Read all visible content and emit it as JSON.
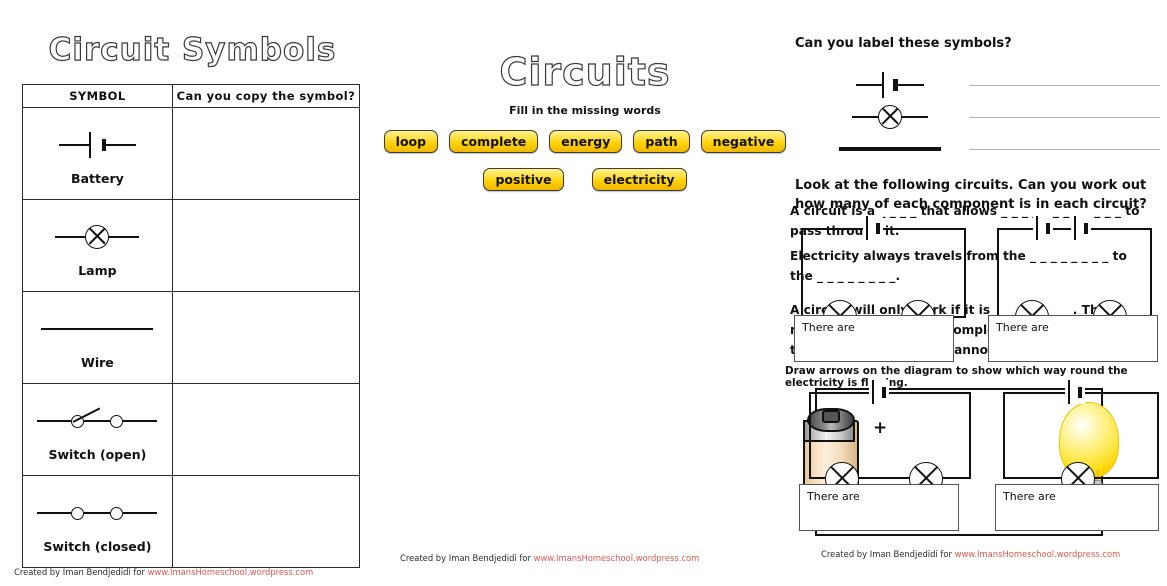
{
  "left": {
    "title": "Circuit Symbols",
    "table": {
      "headers": [
        "SYMBOL",
        "Can you copy the symbol?"
      ],
      "rows": [
        {
          "icon": "battery-symbol",
          "label": "Battery"
        },
        {
          "icon": "lamp-symbol",
          "label": "Lamp"
        },
        {
          "icon": "wire-symbol",
          "label": "Wire"
        },
        {
          "icon": "switch-open-symbol",
          "label": "Switch (open)"
        },
        {
          "icon": "switch-closed-symbol",
          "label": "Switch (closed)"
        }
      ]
    },
    "credit_prefix": "Created by Iman Bendjedidi for ",
    "credit_url": "www.ImansHomeschool.wordpress.com"
  },
  "middle": {
    "title": "Circuits",
    "subtitle": "Fill in the missing words",
    "word_bank_row1": [
      "loop",
      "complete",
      "energy",
      "path",
      "negative"
    ],
    "word_bank_row2": [
      "positive",
      "electricity"
    ],
    "paragraphs": [
      "A circuit is a _ _ _ _  that allows _ _ _ _ _ _ _ _ _ _ _ _ to pass through it.",
      "Electricity always travels from the _ _ _ _ _ _ _ _ to the _ _ _ _ _ _ _ _.",
      "A circuit will only work if it is _ _ _ _ _ _ _ _. This means it must make a complete _ _ _ _, otherwise the electrical _ _ _ _ _ _ cannot flow."
    ],
    "draw_instruction": "Draw arrows on the diagram to show which way round the electricity is flowing.",
    "diagram": {
      "battery_label": "battery-cell",
      "plus_sign": "+",
      "minus_sign": "−",
      "bulb_label": "light-bulb"
    },
    "credit_prefix": "Created by Iman Bendjedidi for ",
    "credit_url": "www.ImansHomeschool.wordpress.com"
  },
  "right": {
    "heading_1": "Can you label these symbols?",
    "label_symbols": [
      "battery-symbol",
      "lamp-symbol",
      "wire-symbol"
    ],
    "heading_2": "Look at the following circuits. Can you work out how many of each component is in each circuit?",
    "circuits": [
      {
        "id": "circuit-1",
        "batteries": 1,
        "lamps": 2,
        "answer_prompt": "There are"
      },
      {
        "id": "circuit-2",
        "batteries": 2,
        "lamps": 2,
        "answer_prompt": "There are"
      },
      {
        "id": "circuit-3",
        "batteries": 1,
        "lamps": 2,
        "answer_prompt": "There are"
      },
      {
        "id": "circuit-4",
        "batteries": 1,
        "lamps": 1,
        "answer_prompt": "There are"
      }
    ],
    "credit_prefix": "Created by Iman Bendjedidi for ",
    "credit_url": "www.ImansHomeschool.wordpress.com"
  },
  "colors": {
    "pill_yellow": "#ffd000",
    "pill_highlight": "#fff08a",
    "ink": "#111111",
    "credit_url": "#e0584f",
    "bulb_glow": "#ffe94f"
  }
}
